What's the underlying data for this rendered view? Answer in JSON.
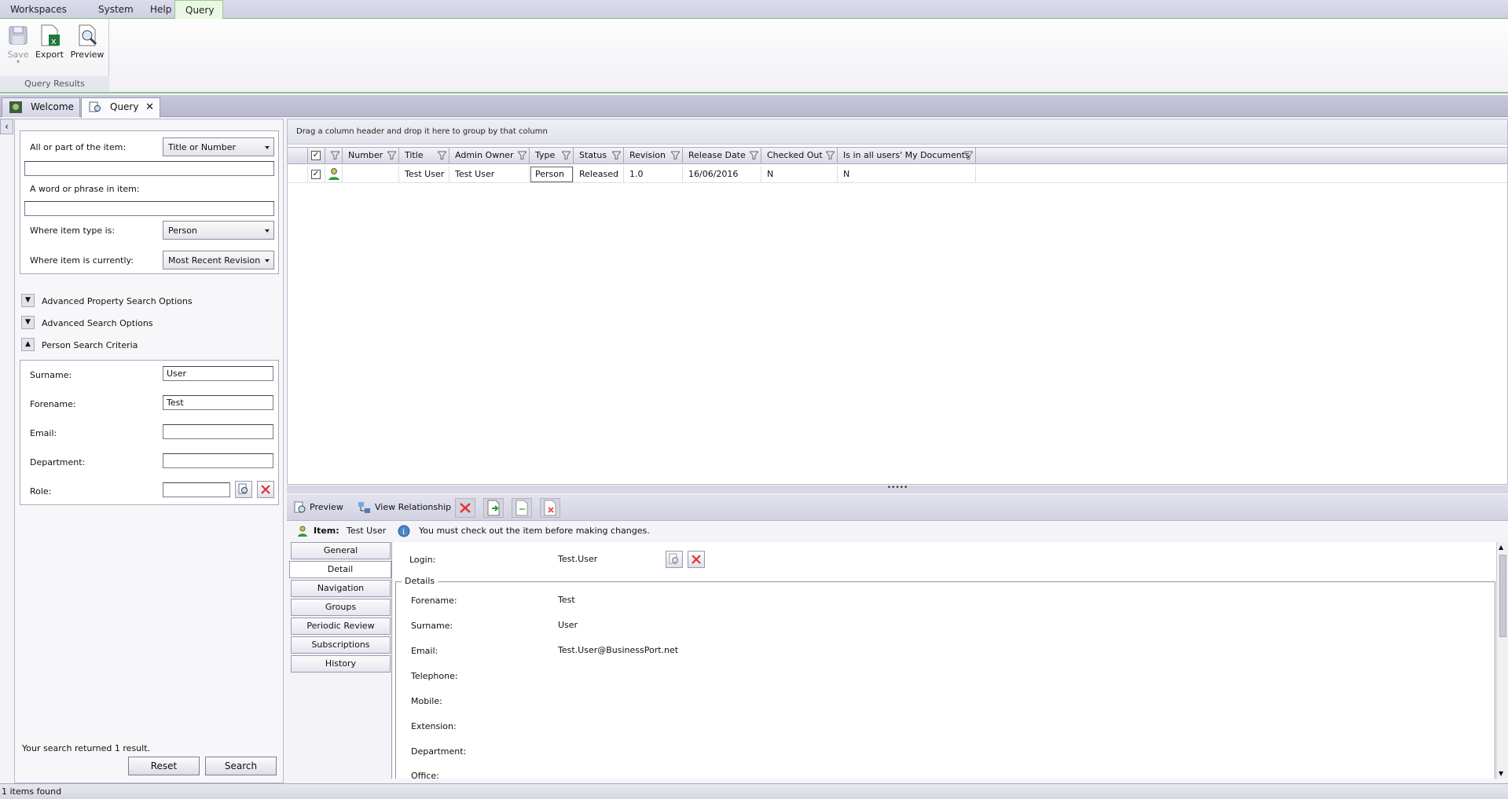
{
  "menu": [
    "Workspaces",
    "System",
    "Help",
    "Query"
  ],
  "ribbon": {
    "buttons": [
      "Save",
      "Export",
      "Preview"
    ],
    "group_label": "Query Results"
  },
  "doc_tabs": [
    "Welcome",
    "Query"
  ],
  "search": {
    "item_label": "All or part of the item:",
    "item_mode": "Title or Number",
    "item_value": "",
    "phrase_label": "A word or phrase in item:",
    "phrase_value": "",
    "type_label": "Where item type is:",
    "type_value": "Person",
    "state_label": "Where item is currently:",
    "state_value": "Most Recent Revision",
    "sections": [
      "Advanced Property Search Options",
      "Advanced Search Options",
      "Person Search Criteria"
    ],
    "person": {
      "surname_label": "Surname:",
      "surname": "User",
      "forename_label": "Forename:",
      "forename": "Test",
      "email_label": "Email:",
      "email": "",
      "department_label": "Department:",
      "department": "",
      "role_label": "Role:",
      "role": ""
    },
    "result_text": "Your search returned 1 result.",
    "reset": "Reset",
    "search_btn": "Search"
  },
  "grid": {
    "group_hint": "Drag a column header and drop it here to group by that column",
    "columns": [
      "Number",
      "Title",
      "Admin Owner",
      "Type",
      "Status",
      "Revision",
      "Release Date",
      "Checked Out",
      "Is in all users' My Documents"
    ],
    "row": [
      "",
      "Test User",
      "Test User",
      "Person",
      "Released",
      "1.0",
      "16/06/2016",
      "N",
      "N"
    ]
  },
  "splitter": "•••••",
  "detail": {
    "toolbar": {
      "preview": "Preview",
      "view_relationship": "View Relationship"
    },
    "item_label": "Item:",
    "item_name": "Test User",
    "info": "You must check out the item before making changes.",
    "tabs": [
      "General",
      "Detail",
      "Navigation",
      "Groups",
      "Periodic Review",
      "Subscriptions",
      "History"
    ],
    "login_label": "Login:",
    "login": "Test.User",
    "group_title": "Details",
    "fields": [
      {
        "label": "Forename:",
        "value": "Test"
      },
      {
        "label": "Surname:",
        "value": "User"
      },
      {
        "label": "Email:",
        "value": "Test.User@BusinessPort.net"
      },
      {
        "label": "Telephone:",
        "value": ""
      },
      {
        "label": "Mobile:",
        "value": ""
      },
      {
        "label": "Extension:",
        "value": ""
      },
      {
        "label": "Department:",
        "value": ""
      },
      {
        "label": "Office:",
        "value": ""
      }
    ]
  },
  "status": "1 items found"
}
